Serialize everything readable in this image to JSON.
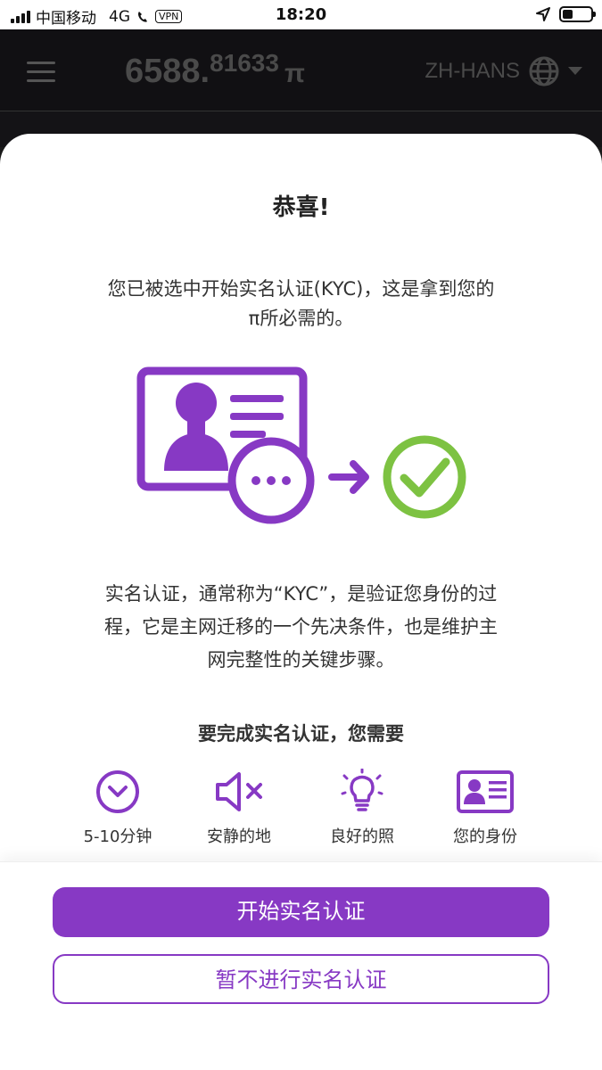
{
  "status_bar": {
    "carrier": "中国移动",
    "network": "4G",
    "vpn": "VPN",
    "time": "18:20"
  },
  "app_header": {
    "balance_int": "6588.",
    "balance_frac": "81633",
    "currency": "π",
    "language": "ZH-HANS"
  },
  "modal": {
    "title": "恭喜!",
    "intro_line1": "您已被选中开始实名认证(KYC)，这是拿到您的",
    "intro_line2": "π所必需的。",
    "desc_line1": "实名认证，通常称为“KYC”，是验证您身份的过",
    "desc_line2": "程，它是主网迁移的一个先决条件，也是维护主",
    "desc_line3": "网完整性的关键步骤。",
    "requirements_title": "要完成实名认证，您需要",
    "requirements": [
      {
        "icon": "clock-icon",
        "label": "5-10分钟"
      },
      {
        "icon": "mute-icon",
        "label": "安静的地"
      },
      {
        "icon": "lightbulb-icon",
        "label": "良好的照"
      },
      {
        "icon": "id-card-icon",
        "label": "您的身份"
      }
    ],
    "primary_button": "开始实名认证",
    "secondary_button": "暂不进行实名认证"
  },
  "colors": {
    "accent_purple": "#8739c4",
    "success_green": "#7dc242"
  }
}
